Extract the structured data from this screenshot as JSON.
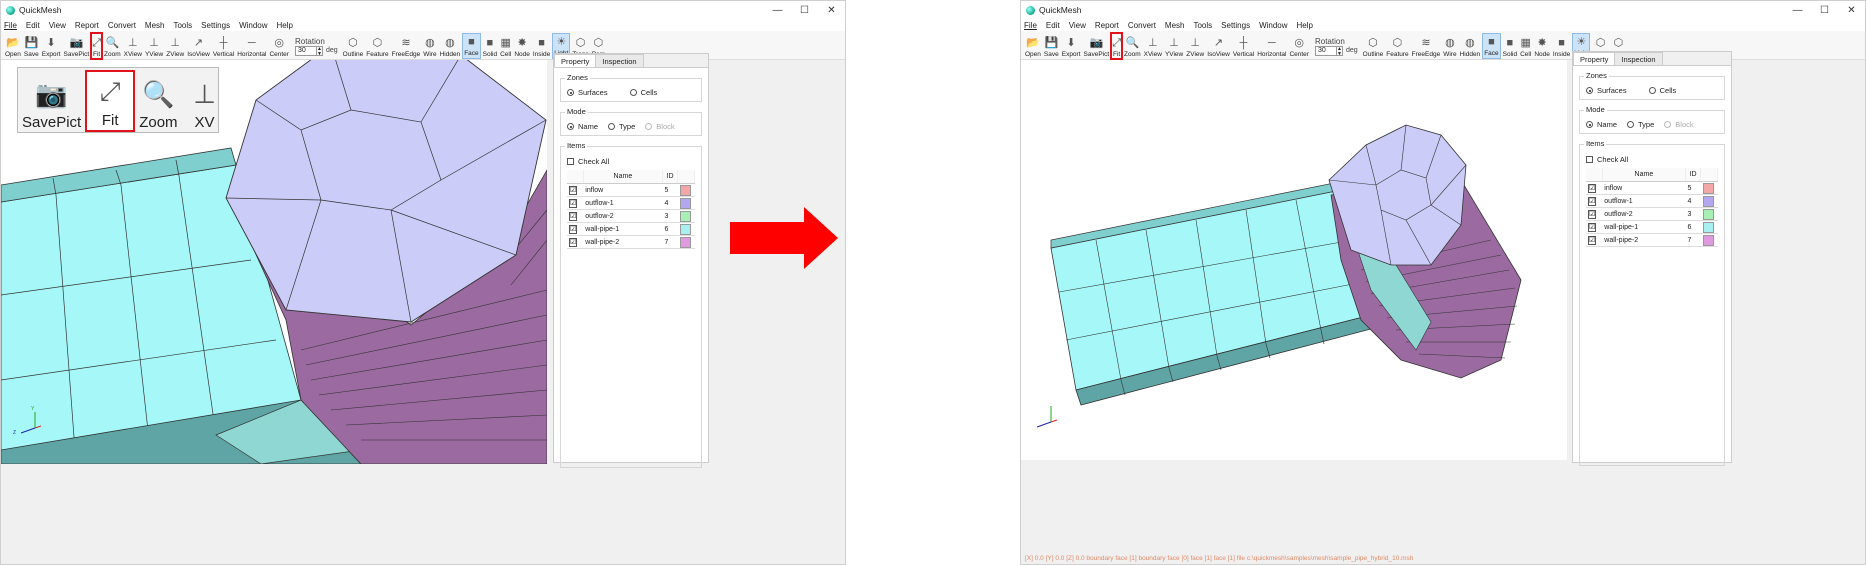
{
  "left": {
    "title": "QuickMesh",
    "window_controls": [
      "—",
      "☐",
      "✕"
    ],
    "menu": [
      "File",
      "Edit",
      "View",
      "Report",
      "Convert",
      "Mesh",
      "Tools",
      "Settings",
      "Window",
      "Help"
    ],
    "toolbar": {
      "buttons_a": [
        {
          "icon": "📂",
          "label": "Open"
        },
        {
          "icon": "💾",
          "label": "Save"
        },
        {
          "icon": "⬇",
          "label": "Export"
        },
        {
          "icon": "📷",
          "label": "SavePict"
        },
        {
          "icon": "⤢",
          "label": "Fit"
        },
        {
          "icon": "🔍",
          "label": "Zoom"
        },
        {
          "icon": "⊥",
          "label": "XView"
        },
        {
          "icon": "⊥",
          "label": "YView"
        },
        {
          "icon": "⊥",
          "label": "ZView"
        },
        {
          "icon": "↗",
          "label": "IsoView"
        },
        {
          "icon": "┼",
          "label": "Vertical"
        },
        {
          "icon": "─",
          "label": "Horizontal"
        },
        {
          "icon": "◎",
          "label": "Center"
        }
      ],
      "rotation_label": "Rotation",
      "rotation_value": "30",
      "rotation_unit": "deg",
      "buttons_b": [
        {
          "icon": "⬡",
          "label": "Outline"
        },
        {
          "icon": "⬡",
          "label": "Feature"
        },
        {
          "icon": "≋",
          "label": "FreeEdge"
        },
        {
          "icon": "◍",
          "label": "Wire"
        },
        {
          "icon": "◍",
          "label": "Hidden"
        },
        {
          "icon": "■",
          "label": "Face"
        },
        {
          "icon": "■",
          "label": "Solid"
        },
        {
          "icon": "▦",
          "label": "Cell"
        },
        {
          "icon": "✸",
          "label": "Node"
        },
        {
          "icon": "■",
          "label": "Inside"
        },
        {
          "icon": "☀",
          "label": "Light"
        },
        {
          "icon": "⬡",
          "label": "Trans"
        },
        {
          "icon": "⬡",
          "label": "Pers"
        }
      ]
    },
    "zoom_callout": [
      {
        "label": "SavePict",
        "icon": "📷"
      },
      {
        "label": "Fit",
        "icon": "⤢"
      },
      {
        "label": "Zoom",
        "icon": "🔍"
      },
      {
        "label": "XV",
        "icon": "⊥"
      }
    ],
    "panel": {
      "tabs": [
        "Property",
        "Inspection"
      ],
      "zones_label": "Zones",
      "zones": [
        "Surfaces",
        "Cells"
      ],
      "mode_label": "Mode",
      "modes": [
        "Name",
        "Type",
        "Block"
      ],
      "items_label": "Items",
      "check_all": "Check All",
      "columns": [
        "Name",
        "ID"
      ],
      "rows": [
        {
          "check": "☑",
          "name": "inflow",
          "id": "5",
          "color": "#f4a7a7"
        },
        {
          "check": "☑",
          "name": "outflow-1",
          "id": "4",
          "color": "#b3a8ef"
        },
        {
          "check": "☑",
          "name": "outflow-2",
          "id": "3",
          "color": "#a7efb3"
        },
        {
          "check": "☑",
          "name": "wall-pipe-1",
          "id": "6",
          "color": "#a7eff0"
        },
        {
          "check": "☑",
          "name": "wall-pipe-2",
          "id": "7",
          "color": "#e09ae0"
        }
      ]
    },
    "axis": {
      "y": "Y",
      "z": "Z"
    }
  },
  "right": {
    "title": "QuickMesh",
    "status_text": "[X] 0.0 [Y] 0.0 [Z] 0.0 boundary face [1] boundary face [0] face [1] face [1] file c:\\quickmesh\\samples\\mesh\\sample_pipe_hybrid_10.msh"
  },
  "colors": {
    "accent_red": "#e0121a",
    "cyan_face": "#a6f7f7",
    "cyan_dark": "#5fa5a5",
    "purple_face": "#9a6aa0",
    "lavender_face": "#ccccf8"
  }
}
